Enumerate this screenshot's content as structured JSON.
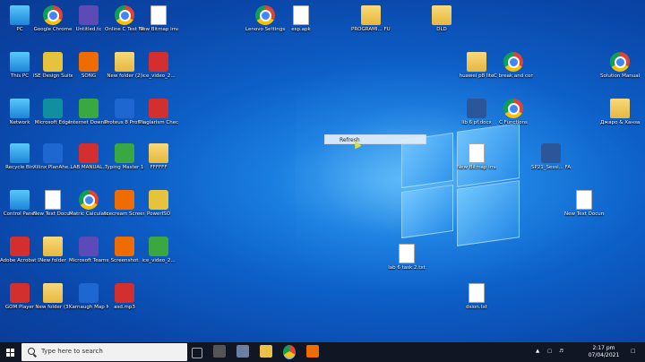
{
  "desktop_icons": [
    {
      "label": "PC",
      "type": "pc"
    },
    {
      "label": "Google Chrome",
      "type": "chrome"
    },
    {
      "label": "Untitled.tc",
      "type": "purple"
    },
    {
      "label": "Online C Test While Loo...",
      "type": "chrome"
    },
    {
      "label": "New Bitmap image.bmp",
      "type": "doc"
    },
    {
      "label": "Lenovo Settings - ...",
      "type": "chrome"
    },
    {
      "label": "esp.apk",
      "type": "doc"
    },
    {
      "label": "PROGRAMI... FUNDAME...",
      "type": "folder"
    },
    {
      "label": "DLD",
      "type": "folder"
    },
    {
      "label": "This PC",
      "type": "pc"
    },
    {
      "label": "ISE Design Suite 14.7",
      "type": "yellow"
    },
    {
      "label": "SONG",
      "type": "orange"
    },
    {
      "label": "New folder (2)",
      "type": "folder"
    },
    {
      "label": "ice_video_2...",
      "type": "red"
    },
    {
      "label": "huawei p8 lite",
      "type": "folder"
    },
    {
      "label": "C break and continue",
      "type": "chrome"
    },
    {
      "label": "Solution Manual fo...",
      "type": "chrome"
    },
    {
      "label": "Network",
      "type": "pc"
    },
    {
      "label": "Microsoft Edge",
      "type": "teal"
    },
    {
      "label": "Internet Downlo...",
      "type": "green"
    },
    {
      "label": "Proteus 8 Professional",
      "type": "blue"
    },
    {
      "label": "Plagiarism Checker X",
      "type": "red"
    },
    {
      "label": "lib 6 pf.docx",
      "type": "word"
    },
    {
      "label": "C Functions",
      "type": "chrome"
    },
    {
      "label": "Джаро & Ханза - T...",
      "type": "folder"
    },
    {
      "label": "Recycle Bin",
      "type": "pc"
    },
    {
      "label": "Xilinx PlanAhe...",
      "type": "blue"
    },
    {
      "label": "LAB MANUAL...",
      "type": "red"
    },
    {
      "label": "Typing Master 10",
      "type": "green"
    },
    {
      "label": "FFFFFF",
      "type": "folder"
    },
    {
      "label": "New Bitmap image.png",
      "type": "doc"
    },
    {
      "label": "SP21_Sessi... FA20-BCE-...",
      "type": "word"
    },
    {
      "label": "Control Panel",
      "type": "pc"
    },
    {
      "label": "New Text Document...",
      "type": "doc"
    },
    {
      "label": "Matric Calculato...",
      "type": "chrome"
    },
    {
      "label": "Icecream Screen Recorder",
      "type": "orange"
    },
    {
      "label": "PowerISO",
      "type": "yellow"
    },
    {
      "label": "New Text Docume...",
      "type": "doc"
    },
    {
      "label": "Adobe Acrobat DC",
      "type": "red"
    },
    {
      "label": "New folder",
      "type": "folder"
    },
    {
      "label": "Microsoft Teams",
      "type": "purple"
    },
    {
      "label": "Screenshot",
      "type": "orange"
    },
    {
      "label": "ice_video_2...",
      "type": "green"
    },
    {
      "label": "lab 6 task 2.txt",
      "type": "doc"
    },
    {
      "label": "GOM Player",
      "type": "red"
    },
    {
      "label": "New folder (3)",
      "type": "folder"
    },
    {
      "label": "Karnaugh Map Mi...",
      "type": "blue"
    },
    {
      "label": "asd.mp3",
      "type": "red"
    },
    {
      "label": "dsion.txt",
      "type": "doc"
    }
  ],
  "context_menu": {
    "item": "Refresh"
  },
  "taskbar": {
    "search_placeholder": "Type here to search",
    "time": "2:17 pm",
    "date": "07/04/2021"
  }
}
